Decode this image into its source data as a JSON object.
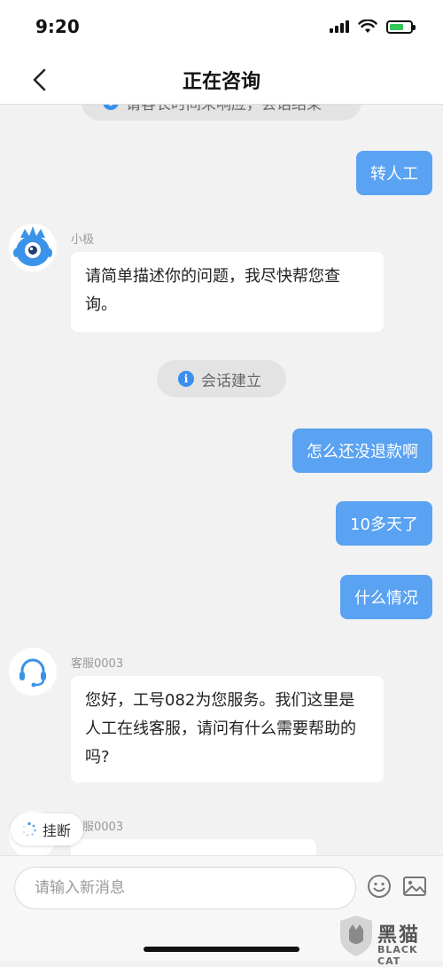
{
  "status_bar": {
    "time": "9:20"
  },
  "header": {
    "title": "正在咨询"
  },
  "chat": {
    "top_notice_partial": "请客长时间未响应，会话结束",
    "messages": [
      {
        "side": "right",
        "text": "转人工"
      },
      {
        "side": "left",
        "sender": "小极",
        "text": "请简单描述你的问题，我尽快帮您查询。"
      },
      {
        "side": "system",
        "text": "会话建立"
      },
      {
        "side": "right",
        "text": "怎么还没退款啊"
      },
      {
        "side": "right",
        "text": "10多天了"
      },
      {
        "side": "right",
        "text": "什么情况"
      },
      {
        "side": "left",
        "sender": "客服0003",
        "text": "您好，工号082为您服务。我们这里是人工在线客服，请问有什么需要帮助的 吗?"
      },
      {
        "side": "left",
        "sender": "客服0003",
        "text": ""
      }
    ]
  },
  "hangup": {
    "label": "挂断"
  },
  "input": {
    "placeholder": "请输入新消息",
    "value": ""
  },
  "watermark": {
    "cn": "黑猫",
    "en": "BLACK CAT"
  },
  "colors": {
    "accent": "#5aa2f2",
    "background": "#f2f2f2",
    "info": "#3b8ff0"
  }
}
